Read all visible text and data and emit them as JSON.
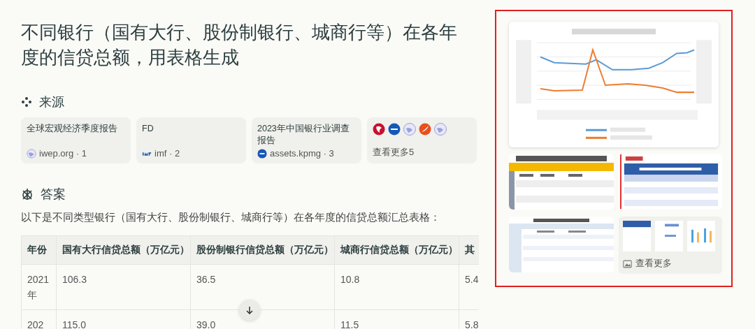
{
  "title": "不同银行（国有大行、股份制银行、城商行等）在各年度的信贷总额，用表格生成",
  "sources": {
    "heading": "来源",
    "items": [
      {
        "title": "全球宏观经济季度报告",
        "site": "iwep.org · 1"
      },
      {
        "title": "FD",
        "site": "imf · 2"
      },
      {
        "title": "2023年中国银行业调查报告",
        "site": "assets.kpmg · 3"
      }
    ],
    "more": {
      "label": "查看更多5"
    }
  },
  "answer": {
    "heading": "答案",
    "intro": "以下是不同类型银行（国有大行、股份制银行、城商行等）在各年度的信贷总额汇总表格：",
    "table": {
      "columns": [
        "年份",
        "国有大行信贷总额（万亿元）",
        "股份制银行信贷总额（万亿元）",
        "城商行信贷总额（万亿元）",
        "其"
      ],
      "rows": [
        [
          "2021年",
          "106.3",
          "36.5",
          "10.8",
          "5.4"
        ],
        [
          "202",
          "115.0",
          "39.0",
          "11.5",
          "5.8"
        ]
      ]
    }
  },
  "media": {
    "more_label": "查看更多"
  }
}
